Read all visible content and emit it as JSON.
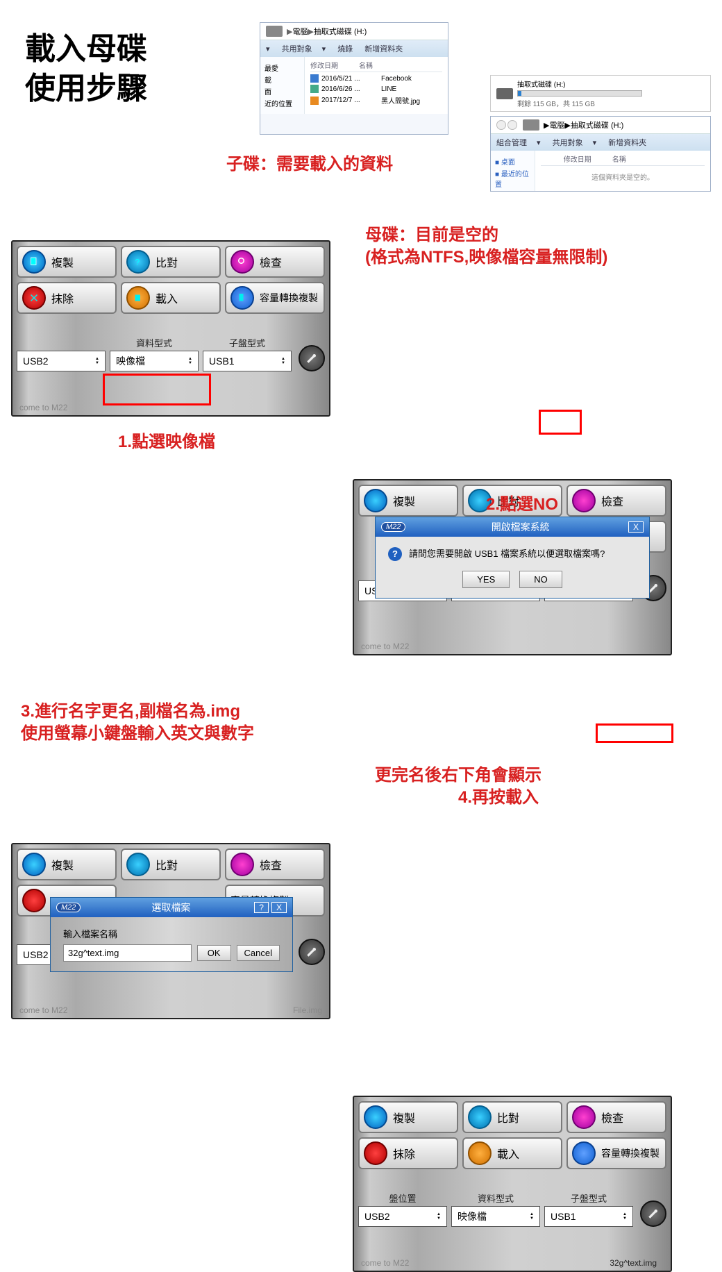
{
  "title_line1": "載入母碟",
  "title_line2": "使用步驟",
  "explorer1": {
    "path1": "電腦",
    "path2": "抽取式磁碟 (H:)",
    "nav_share": "共用對象",
    "nav_burn": "燒錄",
    "nav_newfolder": "新增資料夾",
    "side_fav": "最愛",
    "side_dl": "載",
    "side_desk": "面",
    "side_recent": "近的位置",
    "col_date": "修改日期",
    "col_name": "名稱",
    "rows": [
      {
        "date": "2016/5/21 ...",
        "name": "Facebook"
      },
      {
        "date": "2016/6/26 ...",
        "name": "LINE"
      },
      {
        "date": "2017/12/7 ...",
        "name": "黑人問號.jpg"
      }
    ]
  },
  "child_label": "子碟：需要載入的資料",
  "explorer2": {
    "drive_label": "抽取式磁碟 (H:)",
    "space": "剩餘 115 GB，共 115 GB",
    "path1": "電腦",
    "path2": "抽取式磁碟 (H:)",
    "nav_org": "組合管理",
    "nav_share": "共用對象",
    "nav_newfolder": "新增資料夾",
    "side_desk": "桌面",
    "side_recent": "最近的位置",
    "col_date": "修改日期",
    "col_name": "名稱",
    "empty": "這個資料夾是空的。"
  },
  "mother_label_1": "母碟：目前是空的",
  "mother_label_2": "(格式為NTFS,映像檔容量無限制)",
  "m22": {
    "btn_copy": "複製",
    "btn_compare": "比對",
    "btn_check": "檢查",
    "btn_erase": "抹除",
    "btn_load": "載入",
    "btn_capacity": "容量轉換複製",
    "lbl_position": "盤位置",
    "lbl_datatype": "資料型式",
    "lbl_disktype": "子盤型式",
    "sel_usb2": "USB2",
    "sel_image": "映像檔",
    "sel_usb1": "USB1",
    "watermark": "come to M22",
    "watermark_r": "File.img"
  },
  "step1": "1.點選映像檔",
  "dlg_open": {
    "badge": "M22",
    "title": "開啟檔案系統",
    "msg": "請問您需要開啟 USB1 檔案系統以便選取檔案嗎?",
    "yes": "YES",
    "no": "NO"
  },
  "step2": "2.點選NO",
  "dlg_select": {
    "badge": "M22",
    "title": "選取檔案",
    "label": "輸入檔案名稱",
    "value": "32g^text.img",
    "ok": "OK",
    "cancel": "Cancel"
  },
  "step3a": "3.進行名字更名,副檔名為.img",
  "step3b": "使用螢幕小鍵盤輸入英文與數字",
  "result_file": "32g^text.img",
  "step4a": "更完名後右下角會顯示",
  "step4b": "4.再按載入"
}
